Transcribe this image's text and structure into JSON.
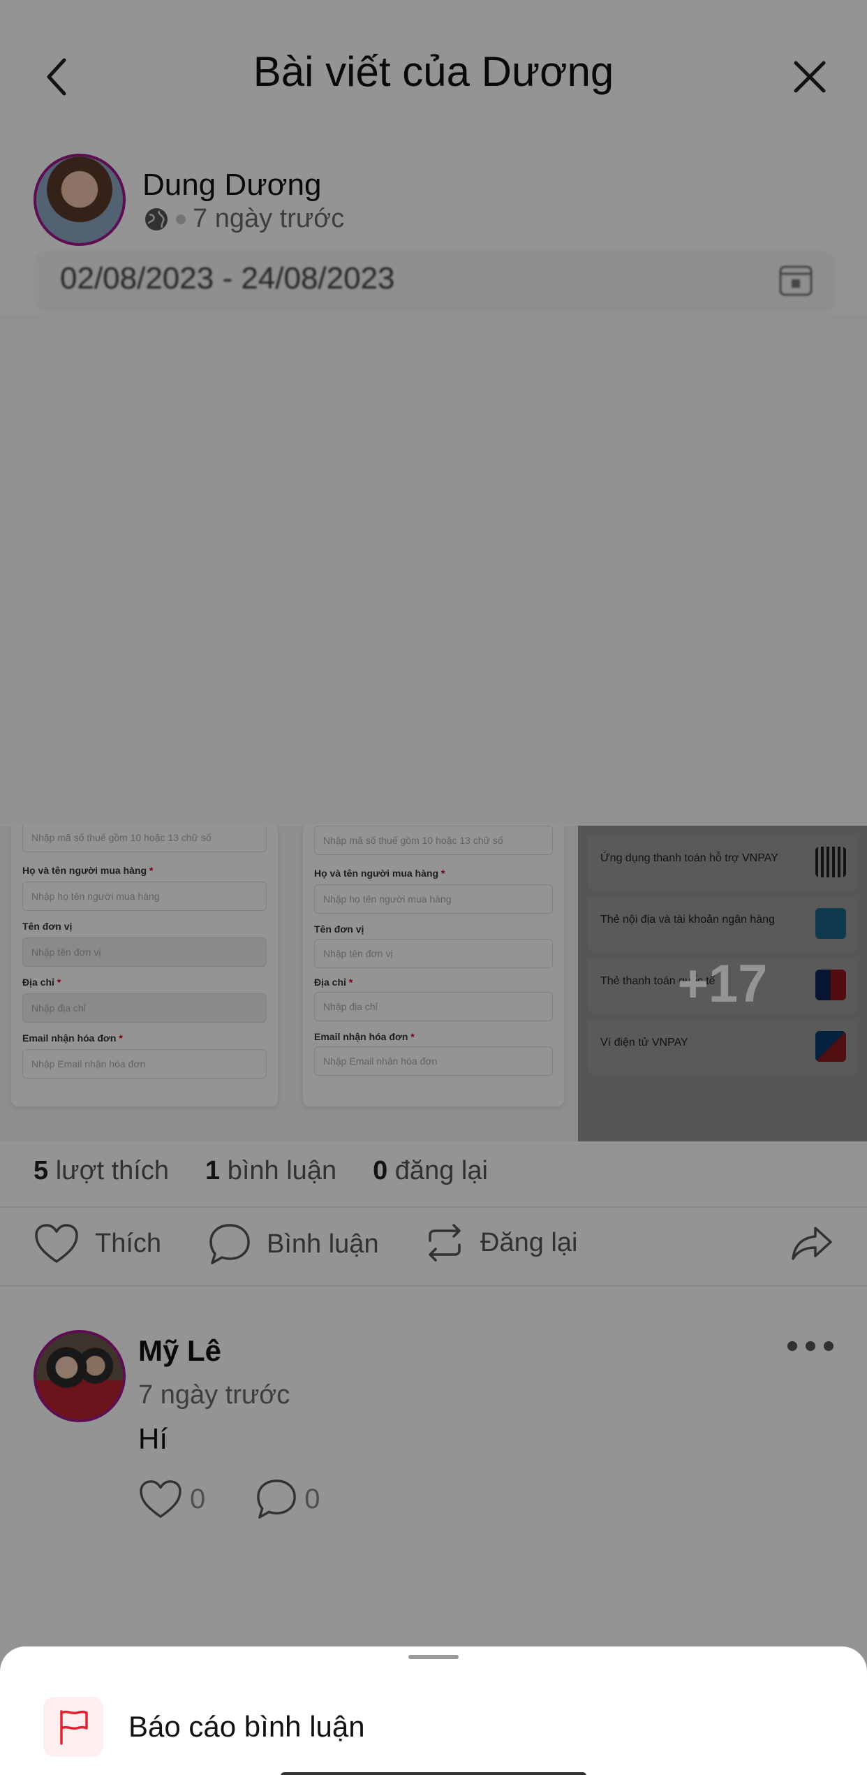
{
  "header": {
    "title": "Bài viết của Dương"
  },
  "post": {
    "author": "Dung Dương",
    "time": "7 ngày trước",
    "date_range": "02/08/2023 - 24/08/2023"
  },
  "form_preview": {
    "tax_placeholder": "Nhập mã số thuế gồm 10 hoặc 13 chữ số",
    "buyer_label": "Họ và tên người mua hàng",
    "buyer_placeholder": "Nhập họ tên người mua hàng",
    "unit_label": "Tên đơn vị",
    "unit_placeholder": "Nhập tên đơn vị",
    "address_label": "Địa chỉ",
    "address_placeholder": "Nhập địa chỉ",
    "email_label": "Email nhận hóa đơn",
    "email_placeholder": "Nhập Email nhận hóa đơn",
    "required_mark": "*"
  },
  "payment_preview": {
    "rows": [
      "Ứng dụng thanh toán hỗ trợ VNPAY",
      "Thẻ nội địa và tài khoản ngân hàng",
      "Thẻ thanh toán quốc tế",
      "Ví điện tử VNPAY"
    ],
    "more_count": "+17"
  },
  "stats": {
    "likes_count": "5",
    "likes_label": "lượt thích",
    "comments_count": "1",
    "comments_label": "bình luận",
    "reposts_count": "0",
    "reposts_label": "đăng lại"
  },
  "actions": {
    "like": "Thích",
    "comment": "Bình luận",
    "repost": "Đăng lại"
  },
  "comment": {
    "author": "Mỹ Lê",
    "time": "7 ngày trước",
    "text": "Hí",
    "likes": "0",
    "replies": "0"
  },
  "sheet": {
    "report_label": "Báo cáo bình luận"
  },
  "colors": {
    "avatar_ring": "#a0178d",
    "flag_red": "#e0212f",
    "flag_bg": "#fdeff0",
    "dim_overlay": "rgba(0,0,0,0.42)"
  }
}
